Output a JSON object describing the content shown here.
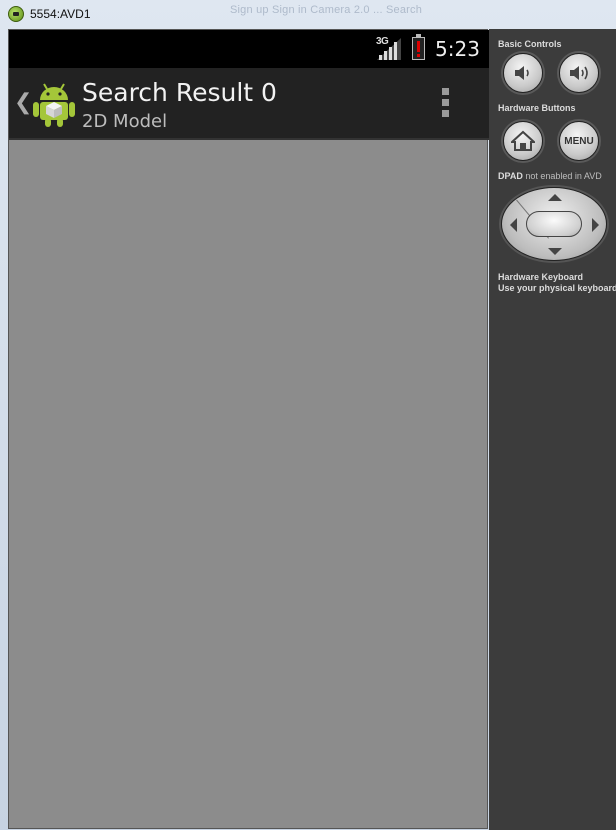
{
  "window": {
    "title": "5554:AVD1",
    "background_tabs_text": "Sign up   Sign in   Camera 2.0   ...   Search"
  },
  "status_bar": {
    "network": "3G",
    "time": "5:23"
  },
  "action_bar": {
    "up_glyph": "❮",
    "title": "Search Result 0",
    "subtitle": "2D Model"
  },
  "controls": {
    "basic_controls_label": "Basic Controls",
    "hardware_buttons_label": "Hardware Buttons",
    "menu_label": "MENU",
    "dpad_label": "DPAD",
    "dpad_note": "not enabled in AVD",
    "keyboard_label": "Hardware Keyboard",
    "keyboard_note": "Use your physical keyboard"
  },
  "colors": {
    "screen_bg": "#8c8c8c",
    "action_bar_bg": "#222222",
    "panel_bg": "#3c3c3c",
    "android_green": "#a4c639"
  },
  "icons": [
    "app-icon",
    "signal-icon",
    "battery-alert-icon",
    "up-chevron-icon",
    "android-logo-icon",
    "overflow-menu-icon",
    "volume-down-icon",
    "volume-up-icon",
    "home-icon",
    "dpad-arrow-icons"
  ]
}
